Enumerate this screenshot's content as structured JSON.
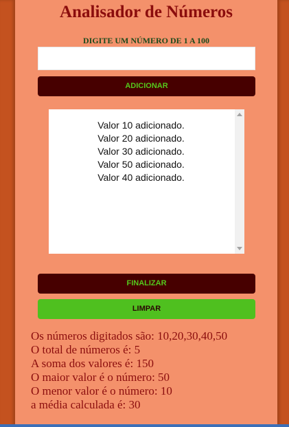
{
  "header": {
    "title": "Analisador de Números",
    "prompt": "DIGITE UM NÚMERO DE 1 A 100"
  },
  "input": {
    "value": "",
    "placeholder": ""
  },
  "buttons": {
    "add_label": "ADICIONAR",
    "finish_label": "FINALIZAR",
    "clear_label": "LIMPAR"
  },
  "list": {
    "items": [
      "Valor 10 adicionado.",
      "Valor 20 adicionado.",
      "Valor 30 adicionado.",
      "Valor 50 adicionado.",
      "Valor 40 adicionado."
    ]
  },
  "results": {
    "lines": [
      "Os números digitados são: 10,20,30,40,50",
      "O total de números é: 5",
      "A soma dos valores é: 150",
      "O maior valor é o número: 50",
      "O menor valor é o número: 10",
      "a média calculada é: 30"
    ]
  },
  "colors": {
    "panel": "#f4916b",
    "side": "#c4521f",
    "title": "#8b0d0d",
    "prompt": "#1c4a1c",
    "dark_button": "#470000",
    "dark_button_text": "#55c81c",
    "green_button": "#4fc01f"
  }
}
